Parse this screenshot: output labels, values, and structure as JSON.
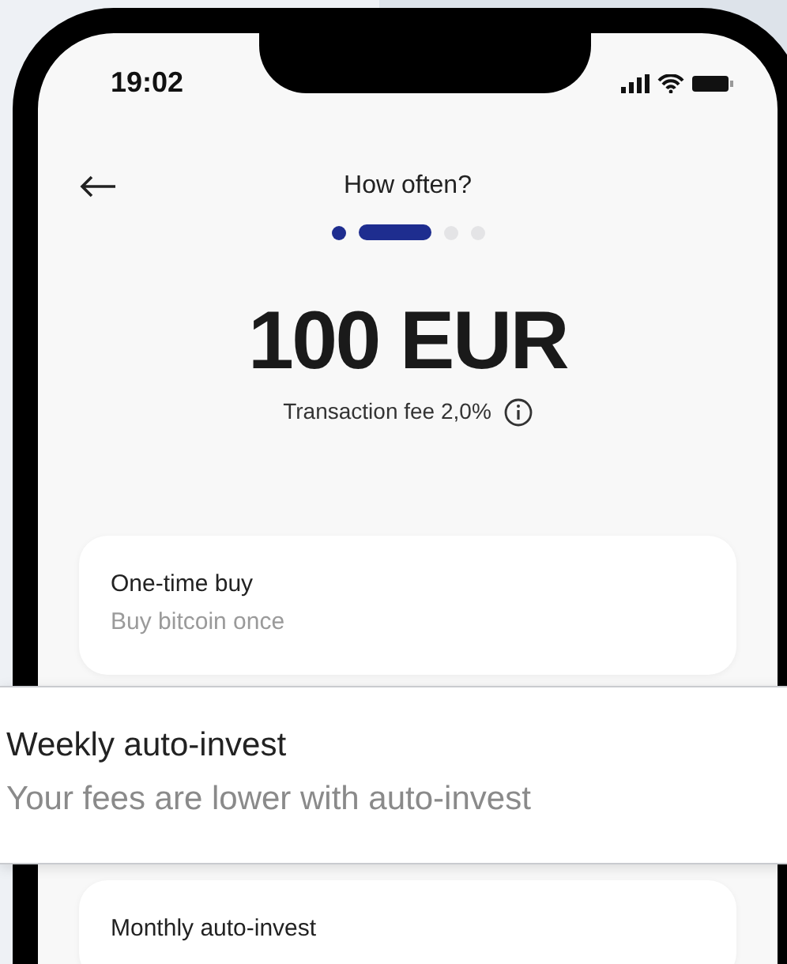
{
  "status_bar": {
    "time": "19:02"
  },
  "header": {
    "title": "How often?"
  },
  "steps": [
    {
      "selected": false,
      "completed": true
    },
    {
      "selected": true
    },
    {
      "selected": false,
      "completed": false
    },
    {
      "selected": false,
      "completed": false
    }
  ],
  "amount": "100 EUR",
  "fee": "Transaction fee 2,0%",
  "options": [
    {
      "title": "One-time buy",
      "subtitle": "Buy bitcoin once",
      "selected": false
    },
    {
      "title": "Weekly auto-invest",
      "subtitle": "Your fees are lower with auto-invest",
      "selected": true
    },
    {
      "title": "Monthly auto-invest",
      "selected": false
    }
  ]
}
